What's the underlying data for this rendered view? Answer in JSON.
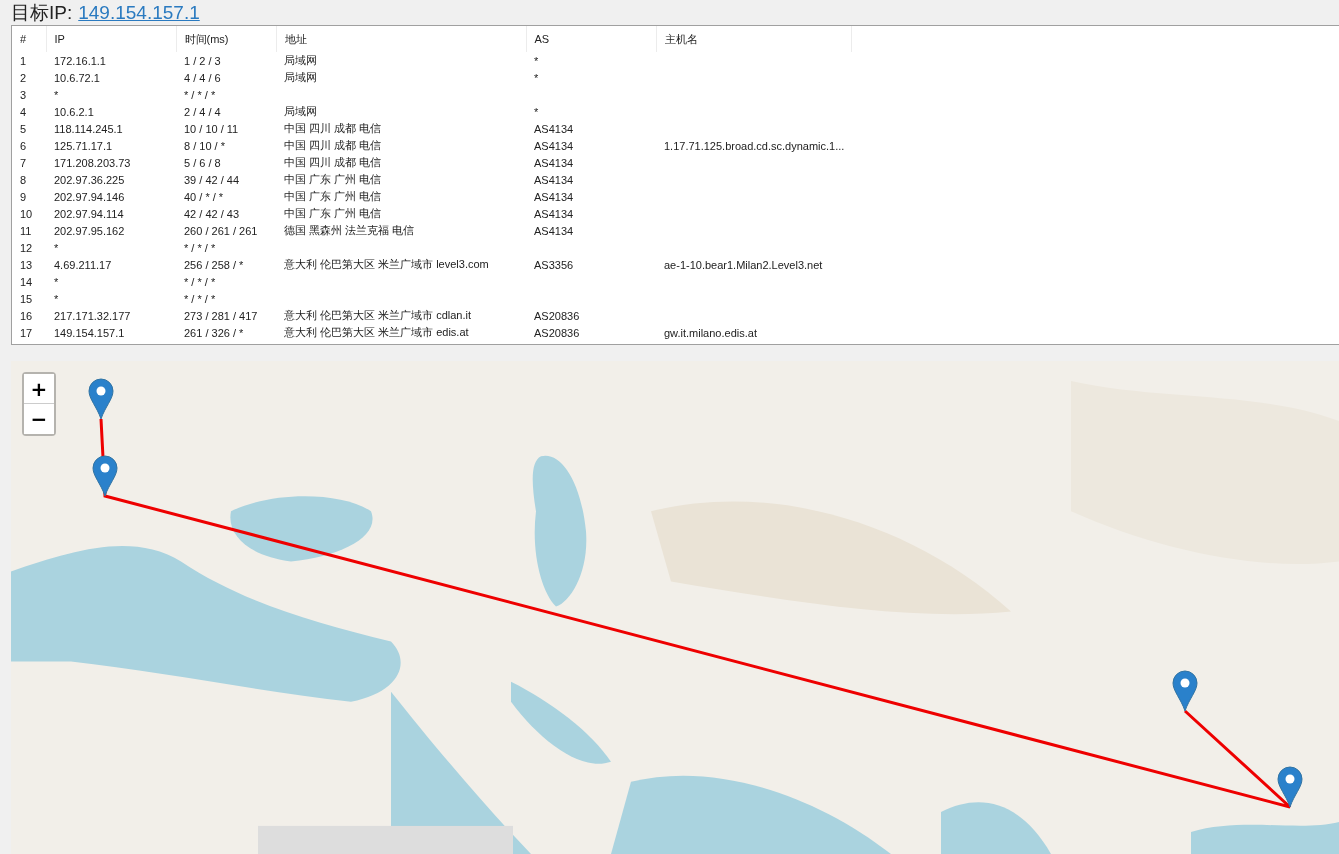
{
  "target": {
    "label": "目标IP:",
    "ip": "149.154.157.1"
  },
  "table": {
    "columns": [
      "#",
      "IP",
      "时间(ms)",
      "地址",
      "AS",
      "主机名"
    ],
    "rows": [
      {
        "n": "1",
        "ip": "172.16.1.1",
        "time": "1 / 2 / 3",
        "addr": "局域网",
        "as": "*"
      },
      {
        "n": "2",
        "ip": "10.6.72.1",
        "time": "4 / 4 / 6",
        "addr": "局域网",
        "as": "*"
      },
      {
        "n": "3",
        "ip": "*",
        "time": "* / * / *"
      },
      {
        "n": "4",
        "ip": "10.6.2.1",
        "time": "2 / 4 / 4",
        "addr": "局域网",
        "as": "*"
      },
      {
        "n": "5",
        "ip": "118.114.245.1",
        "time": "10 / 10 / 11",
        "addr": "中国 四川 成都 电信",
        "as": "AS4134"
      },
      {
        "n": "6",
        "ip": "125.71.17.1",
        "time": "8 / 10 / *",
        "addr": "中国 四川 成都 电信",
        "as": "AS4134",
        "host": "1.17.71.125.broad.cd.sc.dynamic.1..."
      },
      {
        "n": "7",
        "ip": "171.208.203.73",
        "time": "5 / 6 / 8",
        "addr": "中国 四川 成都 电信",
        "as": "AS4134"
      },
      {
        "n": "8",
        "ip": "202.97.36.225",
        "time": "39 / 42 / 44",
        "addr": "中国 广东 广州 电信",
        "as": "AS4134"
      },
      {
        "n": "9",
        "ip": "202.97.94.146",
        "time": "40 / * / *",
        "addr": "中国 广东 广州 电信",
        "as": "AS4134"
      },
      {
        "n": "10",
        "ip": "202.97.94.114",
        "time": "42 / 42 / 43",
        "addr": "中国 广东 广州 电信",
        "as": "AS4134"
      },
      {
        "n": "11",
        "ip": "202.97.95.162",
        "time": "260 / 261 / 261",
        "addr": "德国 黑森州 法兰克福 电信",
        "as": "AS4134"
      },
      {
        "n": "12",
        "ip": "*",
        "time": "* / * / *"
      },
      {
        "n": "13",
        "ip": "4.69.211.17",
        "time": "256 / 258 / *",
        "addr": "意大利 伦巴第大区 米兰广域市 level3.com",
        "as": "AS3356",
        "host": "ae-1-10.bear1.Milan2.Level3.net"
      },
      {
        "n": "14",
        "ip": "*",
        "time": "* / * / *"
      },
      {
        "n": "15",
        "ip": "*",
        "time": "* / * / *"
      },
      {
        "n": "16",
        "ip": "217.171.32.177",
        "time": "273 / 281 / 417",
        "addr": "意大利 伦巴第大区 米兰广域市 cdlan.it",
        "as": "AS20836"
      },
      {
        "n": "17",
        "ip": "149.154.157.1",
        "time": "261 / 326 / *",
        "addr": "意大利 伦巴第大区 米兰广域市 edis.at",
        "as": "AS20836",
        "host": "gw.it.milano.edis.at"
      }
    ]
  },
  "map": {
    "kind": "picture",
    "zoom_in": "+",
    "zoom_out": "−"
  }
}
